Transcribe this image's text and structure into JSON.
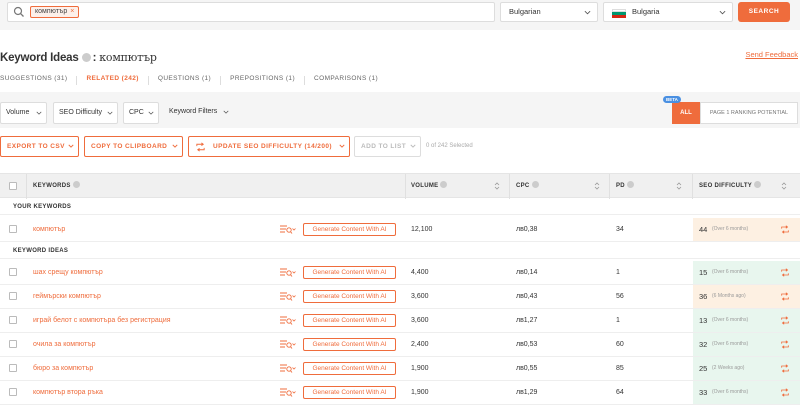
{
  "search": {
    "chip_label": "компютър",
    "chip_remove": "×",
    "language": "Bulgarian",
    "country": "Bulgaria",
    "button_label": "SEARCH"
  },
  "header": {
    "title": "Keyword Ideas",
    "separator": ":",
    "keyword": "компютър",
    "feedback_link": "Send Feedback"
  },
  "tabs": [
    {
      "label": "SUGGESTIONS (31)"
    },
    {
      "label": "RELATED (242)"
    },
    {
      "label": "QUESTIONS (1)"
    },
    {
      "label": "PREPOSITIONS (1)"
    },
    {
      "label": "COMPARISONS (1)"
    }
  ],
  "filters": {
    "volume": "Volume",
    "seo_difficulty": "SEO Difficulty",
    "cpc": "CPC",
    "keyword_filters": "Keyword Filters"
  },
  "ranking_toggle": {
    "badge": "BETA",
    "all": "ALL",
    "page1": "PAGE 1 RANKING POTENTIAL"
  },
  "actions": {
    "export_csv": "EXPORT TO CSV",
    "copy_clipboard": "COPY TO CLIPBOARD",
    "update_seo": "UPDATE SEO DIFFICULTY (14/200)",
    "add_to_list": "ADD TO LIST",
    "selected_count": "0 of 242 Selected"
  },
  "table": {
    "columns": {
      "keywords": "KEYWORDS",
      "volume": "VOLUME",
      "cpc": "CPC",
      "pd": "PD",
      "seo_difficulty": "SEO DIFFICULTY"
    },
    "section_your": "YOUR KEYWORDS",
    "section_ideas": "KEYWORD IDEAS",
    "generate_label": "Generate Content With AI",
    "your_rows": [
      {
        "keyword": "компютър",
        "volume": "12,100",
        "cpc": "лв0,38",
        "pd": "34",
        "sd": "44",
        "age": "(Over 6 months)",
        "sd_color": "#fdf0e2"
      }
    ],
    "idea_rows": [
      {
        "keyword": "шах срещу компютър",
        "volume": "4,400",
        "cpc": "лв0,14",
        "pd": "1",
        "sd": "15",
        "age": "(Over 6 months)",
        "sd_color": "#e8f6ee"
      },
      {
        "keyword": "геймърски компютър",
        "volume": "3,600",
        "cpc": "лв0,43",
        "pd": "56",
        "sd": "36",
        "age": "(6 Months ago)",
        "sd_color": "#fdf0e2"
      },
      {
        "keyword": "играй белот с компютъра без регистрация",
        "volume": "3,600",
        "cpc": "лв1,27",
        "pd": "1",
        "sd": "13",
        "age": "(Over 6 months)",
        "sd_color": "#e8f6ee"
      },
      {
        "keyword": "очила за компютър",
        "volume": "2,400",
        "cpc": "лв0,53",
        "pd": "60",
        "sd": "32",
        "age": "(Over 6 months)",
        "sd_color": "#e8f6ee"
      },
      {
        "keyword": "бюро за компютър",
        "volume": "1,900",
        "cpc": "лв0,55",
        "pd": "85",
        "sd": "25",
        "age": "(2 Weeks ago)",
        "sd_color": "#e8f6ee"
      },
      {
        "keyword": "компютър втора ръка",
        "volume": "1,900",
        "cpc": "лв1,29",
        "pd": "64",
        "sd": "33",
        "age": "(Over 6 months)",
        "sd_color": "#e8f6ee"
      }
    ]
  },
  "colors": {
    "accent": "#ef6c3c",
    "easy": "#e8f6ee",
    "medium": "#fdf0e2"
  }
}
